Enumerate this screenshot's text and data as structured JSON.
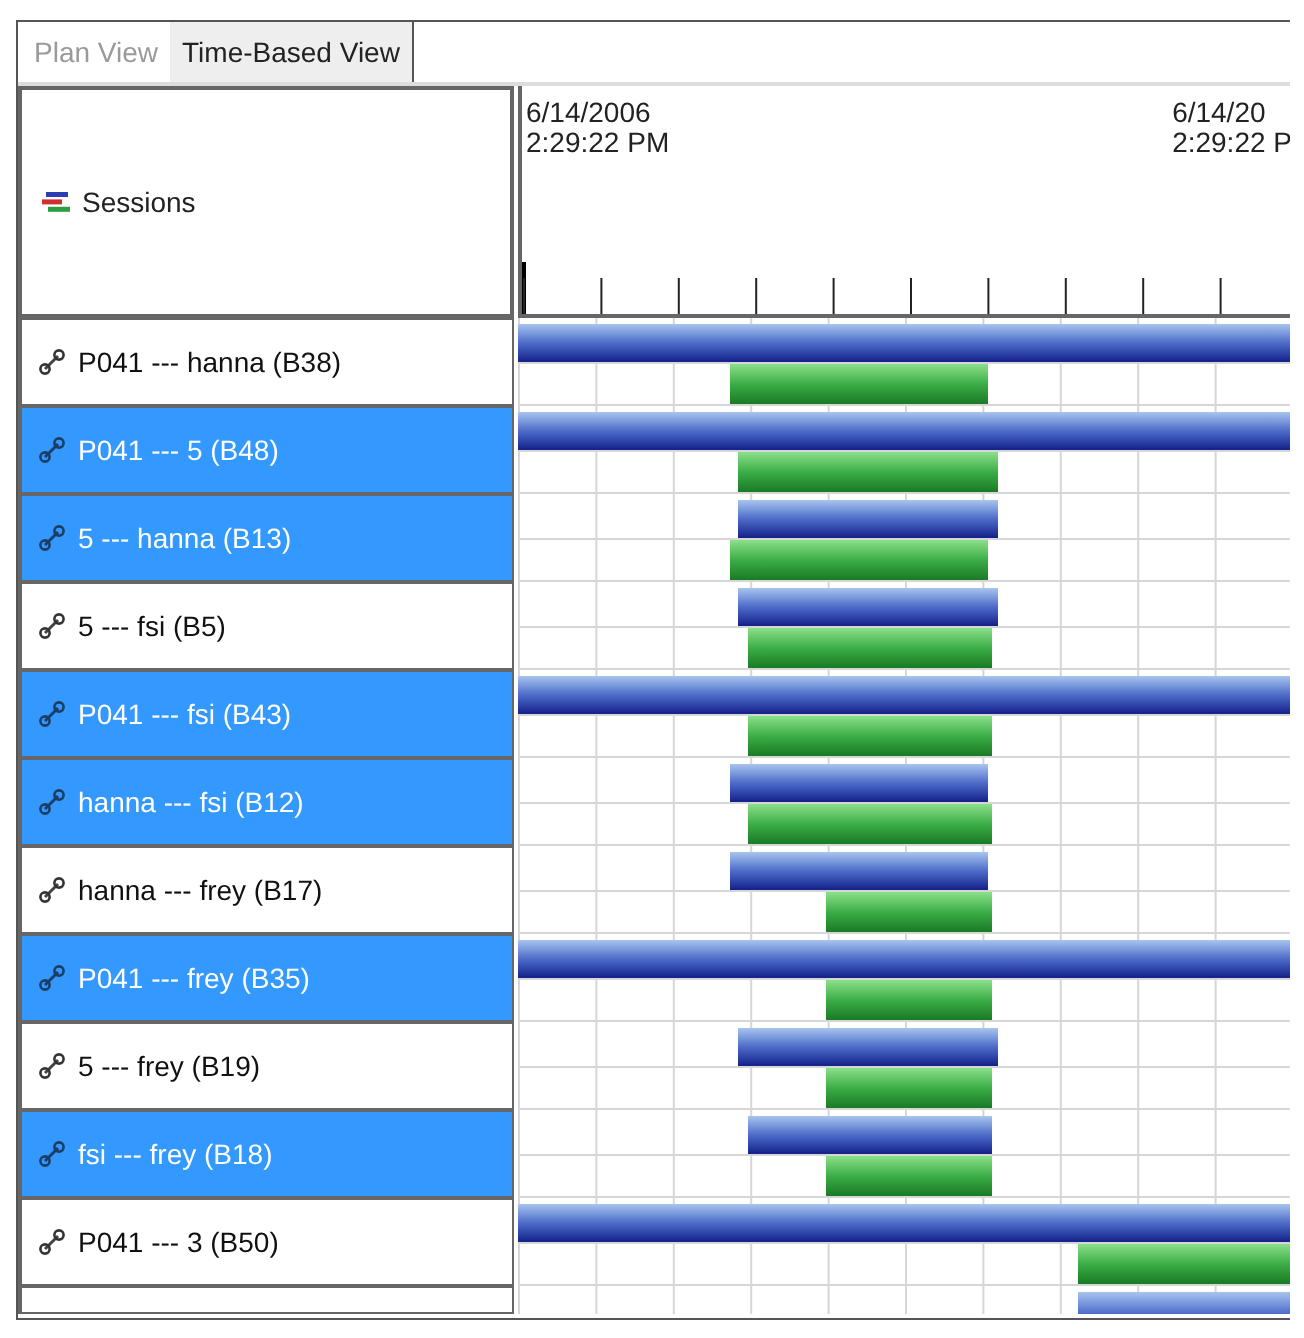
{
  "tabs": [
    {
      "label": "Plan View",
      "selected": false
    },
    {
      "label": "Time-Based View",
      "selected": true
    }
  ],
  "header": {
    "title": "Sessions",
    "time_labels": [
      {
        "date": "6/14/2006",
        "time": "2:29:22 PM"
      },
      {
        "date": "6/14/20",
        "time": "2:29:22 P"
      }
    ]
  },
  "sessions": [
    {
      "label": "P041 --- hanna (B38)",
      "selected": false
    },
    {
      "label": "P041 --- 5 (B48)",
      "selected": true
    },
    {
      "label": "5 --- hanna (B13)",
      "selected": true
    },
    {
      "label": "5 --- fsi (B5)",
      "selected": false
    },
    {
      "label": "P041 --- fsi (B43)",
      "selected": true
    },
    {
      "label": "hanna --- fsi (B12)",
      "selected": true
    },
    {
      "label": "hanna --- frey (B17)",
      "selected": false
    },
    {
      "label": "P041 --- frey (B35)",
      "selected": true
    },
    {
      "label": "5 --- frey (B19)",
      "selected": false
    },
    {
      "label": "fsi --- frey (B18)",
      "selected": true
    },
    {
      "label": "P041 --- 3 (B50)",
      "selected": false
    }
  ]
}
